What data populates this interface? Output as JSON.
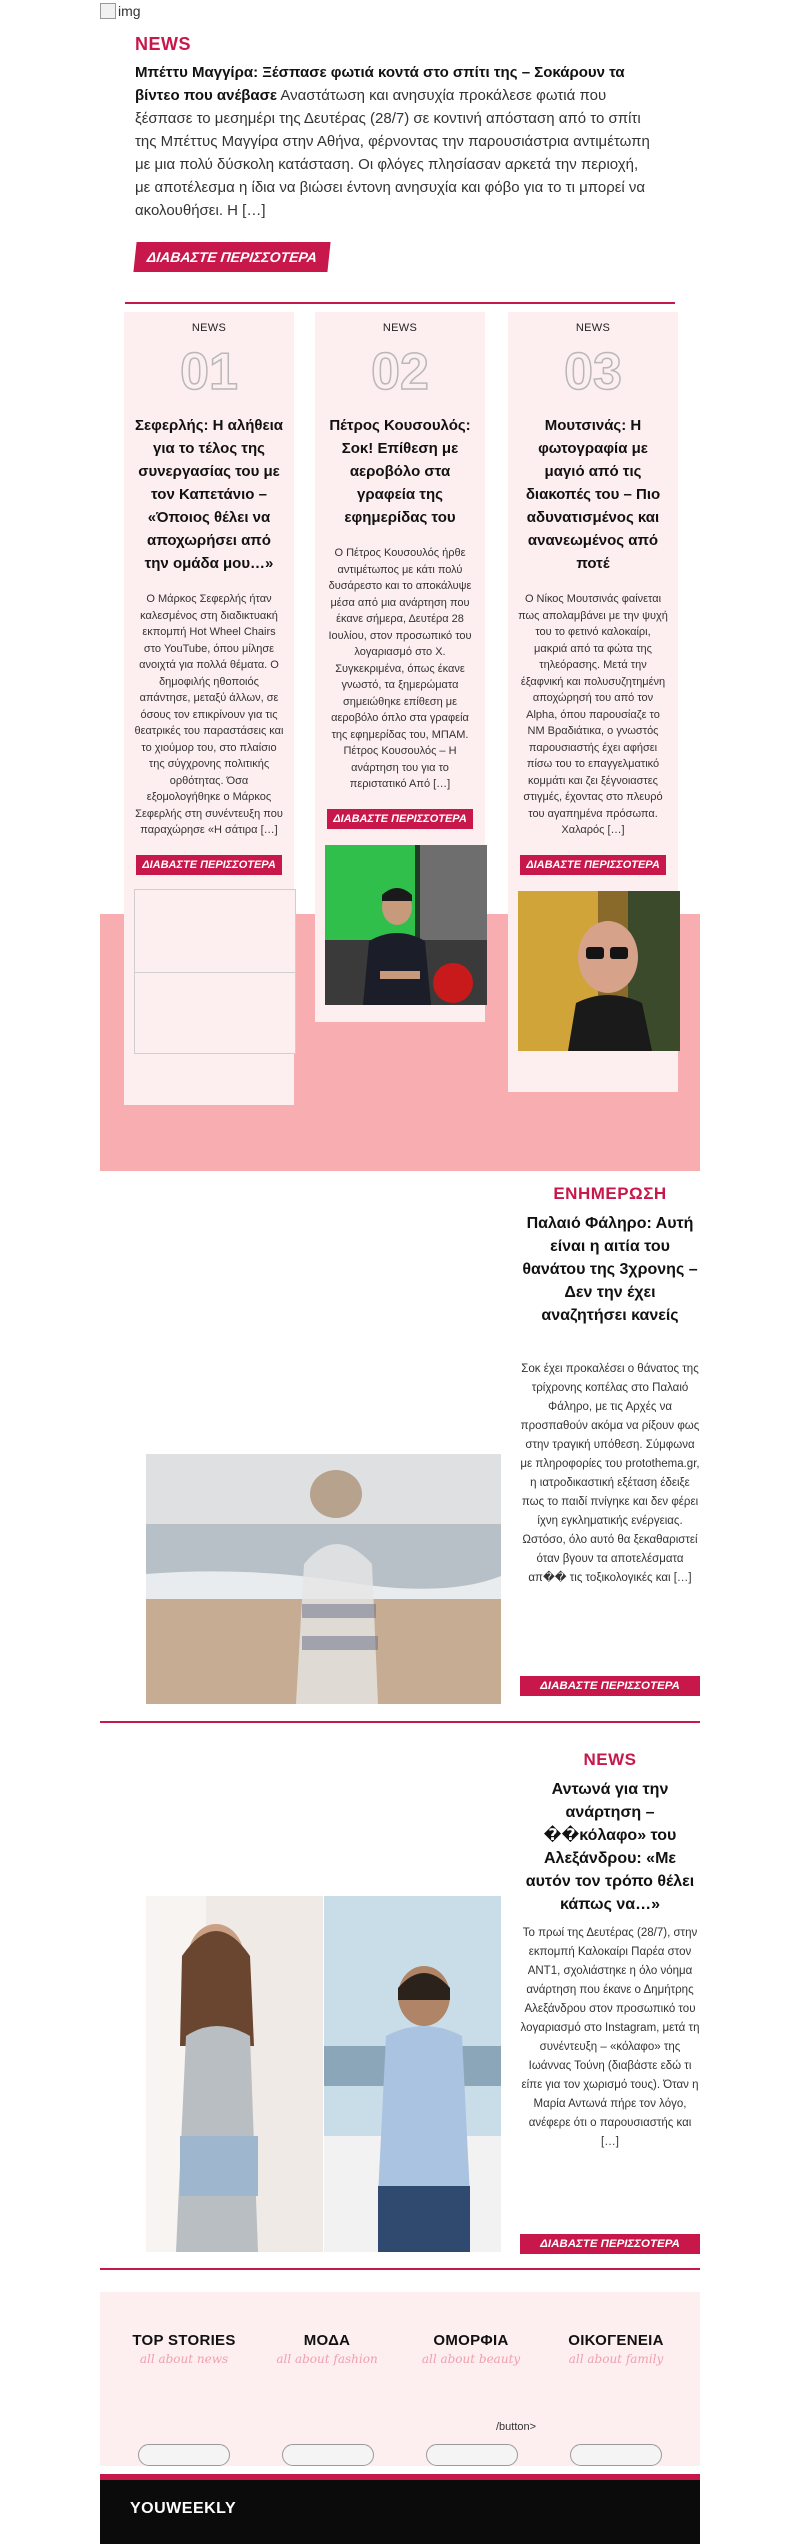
{
  "broken_image": {
    "alt": "img"
  },
  "hero": {
    "category": "NEWS",
    "title": "Μπέττυ Μαγγίρα: Ξέσπασε φωτιά κοντά στο σπίτι της – Σοκάρουν τα βίντεο που ανέβασε",
    "excerpt": "Αναστάτωση και ανησυχία προκάλεσε φωτιά που ξέσπασε το μεσημέρι της Δευτέρας (28/7) σε κοντινή απόσταση από το σπίτι της Μπέττυς Μαγγίρα στην Αθήνα, φέρνοντας την παρουσιάστρια αντιμέτωπη με μια πολύ δύσκολη κατάσταση. Οι φλόγες πλησίασαν αρκετά την περιοχή, με αποτέλεσμα η ίδια να βιώσει έντονη ανησυχία και φόβο για το τι μπορεί να ακολουθήσει. Η […]",
    "button": "ΔΙΑΒΑΣΤΕ ΠΕΡΙΣΣΟΤΕΡΑ"
  },
  "columns": [
    {
      "category": "NEWS",
      "number": "01",
      "title": "Σεφερλής: Η αλήθεια για το τέλος της συνεργασίας του με τον Καπετάνιο – «Όποιος θέλει να αποχωρήσει από την ομάδα μου…»",
      "excerpt": "Ο Μάρκος Σεφερλής ήταν καλεσμένος στη διαδικτυακή εκπομπή Hot Wheel Chairs στο YouTube, όπου μίλησε ανοιχτά για πολλά θέματα. Ο δημοφιλής ηθοποιός απάντησε, μεταξύ άλλων, σε όσους τον επικρίνουν για τις θεατρικές του παραστάσεις και το χιούμορ του, στο πλαίσιο της σύγχρονης πολιτικής ορθότητας. Όσα εξομολογήθηκε ο Μάρκος Σεφερλής στη συνέντευξη που παραχώρησε «Η σάτιρα […]",
      "button": "ΔΙΑΒΑΣΤΕ ΠΕΡΙΣΣΟΤΕΡΑ"
    },
    {
      "category": "NEWS",
      "number": "02",
      "title": "Πέτρος Κουσουλός: Σοκ! Επίθεση με αεροβόλο στα γραφεία της εφημερίδας του",
      "excerpt": "Ο Πέτρος Κουσουλός ήρθε αντιμέτωπος με κάτι πολύ δυσάρεστο και το αποκάλυψε μέσα από μια ανάρτηση που έκανε σήμερα, Δευτέρα 28 Ιουλίου, στον προσωπικό του λογαριασμό στο Χ. Συγκεκριμένα, όπως έκανε γνωστό, τα ξημερώματα σημειώθηκε επίθεση με αεροβόλο όπλο στα γραφεία της εφημερίδας του, ΜΠΑΜ. Πέτρος Κουσουλός – Η ανάρτηση του για το περιστατικό Από […]",
      "button": "ΔΙΑΒΑΣΤΕ ΠΕΡΙΣΣΟΤΕΡΑ"
    },
    {
      "category": "NEWS",
      "number": "03",
      "title": "Μουτσινάς: Η φωτογραφία με μαγιό από τις διακοπές του – Πιο αδυνατισμένος και ανανεωμένος από ποτέ",
      "excerpt": "Ο Νίκος Μουτσινάς φαίνεται πως απολαμβάνει με την ψυχή του το φετινό καλοκαίρι, μακριά από τα φώτα της τηλεόρασης. Μετά την έξαφνική και πολυσυζητημένη αποχώρησή του από τον Alpha, όπου παρουσίαζε το ΝΜ Βραδιάτικα, ο γνωστός παρουσιαστής έχει αφήσει πίσω του το επαγγελματικό κομμάτι και ζει ξέγνοιαστες στιγμές, έχοντας στο πλευρό του αγαπημένα πρόσωπα. Χαλαρός […]",
      "button": "ΔΙΑΒΑΣΤΕ ΠΕΡΙΣΣΟΤΕΡΑ"
    }
  ],
  "feature1": {
    "category": "ΕΝΗΜΕΡΩΣΗ",
    "title": "Παλαιό Φάληρο: Αυτή είναι η αιτία του θανάτου της 3χρονης – Δεν την έχει αναζητήσει κανείς",
    "excerpt": "Σοκ έχει προκαλέσει ο θάνατος της τρίχρονης κοπέλας στο Παλαιό Φάληρο, με τις Αρχές να προσπαθούν ακόμα να ρίξουν φως στην τραγική υπόθεση. Σύμφωνα με πληροφορίες του protothema.gr, η ιατροδικαστική εξέταση έδειξε πως το παιδί πνίγηκε και δεν φέρει ίχνη εγκληματικής ενέργειας. Ωστόσο, όλο αυτό θα ξεκαθαριστεί όταν βγουν τα αποτελέσματα απ�� τις τοξικολογικές και […]",
    "button": "ΔΙΑΒΑΣΤΕ ΠΕΡΙΣΣΟΤΕΡΑ"
  },
  "feature2": {
    "category": "NEWS",
    "title": "Αντωνά για την ανάρτηση – ��κόλαφο» του Αλεξάνδρου: «Με αυτόν τον τρόπο θέλει κάπως να…»",
    "excerpt": "Το πρωί της Δευτέρας (28/7), στην εκπομπή Καλοκαίρι Παρέα στον ANT1, σχολιάστηκε η όλο νόημα ανάρτηση που έκανε ο Δημήτρης Αλεξάνδρου στον προσωπικό του λογαριασμό στο Instagram, μετά τη συνέντευξη – «κόλαφο» της Ιωάννας Τούνη (διαβάστε εδώ τι είπε για τον χωρισμό τους). Όταν η Μαρία Αντωνά πήρε τον λόγο, ανέφερε ότι ο παρουσιαστής και […]",
    "button": "ΔΙΑΒΑΣΤΕ ΠΕΡΙΣΣΟΤΕΡΑ"
  },
  "footer_sections": [
    {
      "title": "TOP STORIES",
      "subtitle": "all about news"
    },
    {
      "title": "ΜΟΔΑ",
      "subtitle": "all about fashion"
    },
    {
      "title": "ΟΜΟΡΦΙΑ",
      "subtitle": "all about beauty"
    },
    {
      "title": "ΟΙΚΟΓΕΝΕΙΑ",
      "subtitle": "all about family"
    }
  ],
  "footer_stray_text": "/button>",
  "brand": "YOUWEEKLY",
  "colors": {
    "accent": "#c8174a",
    "pink_band": "#f8aeb0",
    "card_bg": "#fdeef0",
    "footer_bar": "#0b0b0b"
  }
}
